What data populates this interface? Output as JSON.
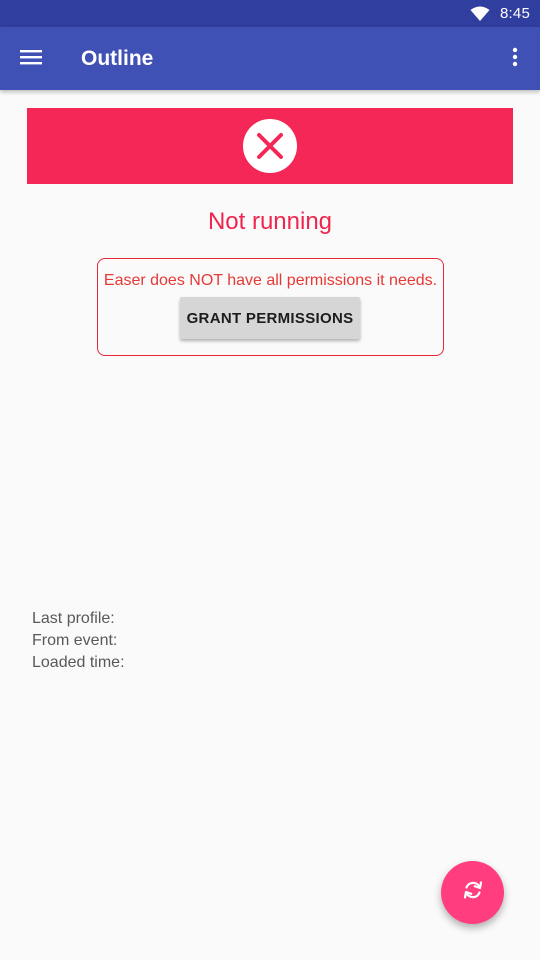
{
  "status_bar": {
    "time": "8:45",
    "wifi_icon": "wifi-icon"
  },
  "app_bar": {
    "title": "Outline",
    "menu_icon": "hamburger-menu-icon",
    "overflow_icon": "more-vert-icon"
  },
  "service_status": {
    "icon": "error-x-icon",
    "state_text": "Not running",
    "banner_color": "#f42756"
  },
  "permissions": {
    "message": "Easer does NOT have all permissions it needs.",
    "button_label": "GRANT PERMISSIONS"
  },
  "info": {
    "last_profile_label": "Last profile:",
    "from_event_label": "From event:",
    "loaded_time_label": "Loaded time:"
  },
  "fab": {
    "icon": "refresh-icon",
    "color": "#ff3d7f"
  },
  "colors": {
    "primary": "#3f51b5",
    "primary_dark": "#303f9f",
    "accent": "#ff4081"
  }
}
